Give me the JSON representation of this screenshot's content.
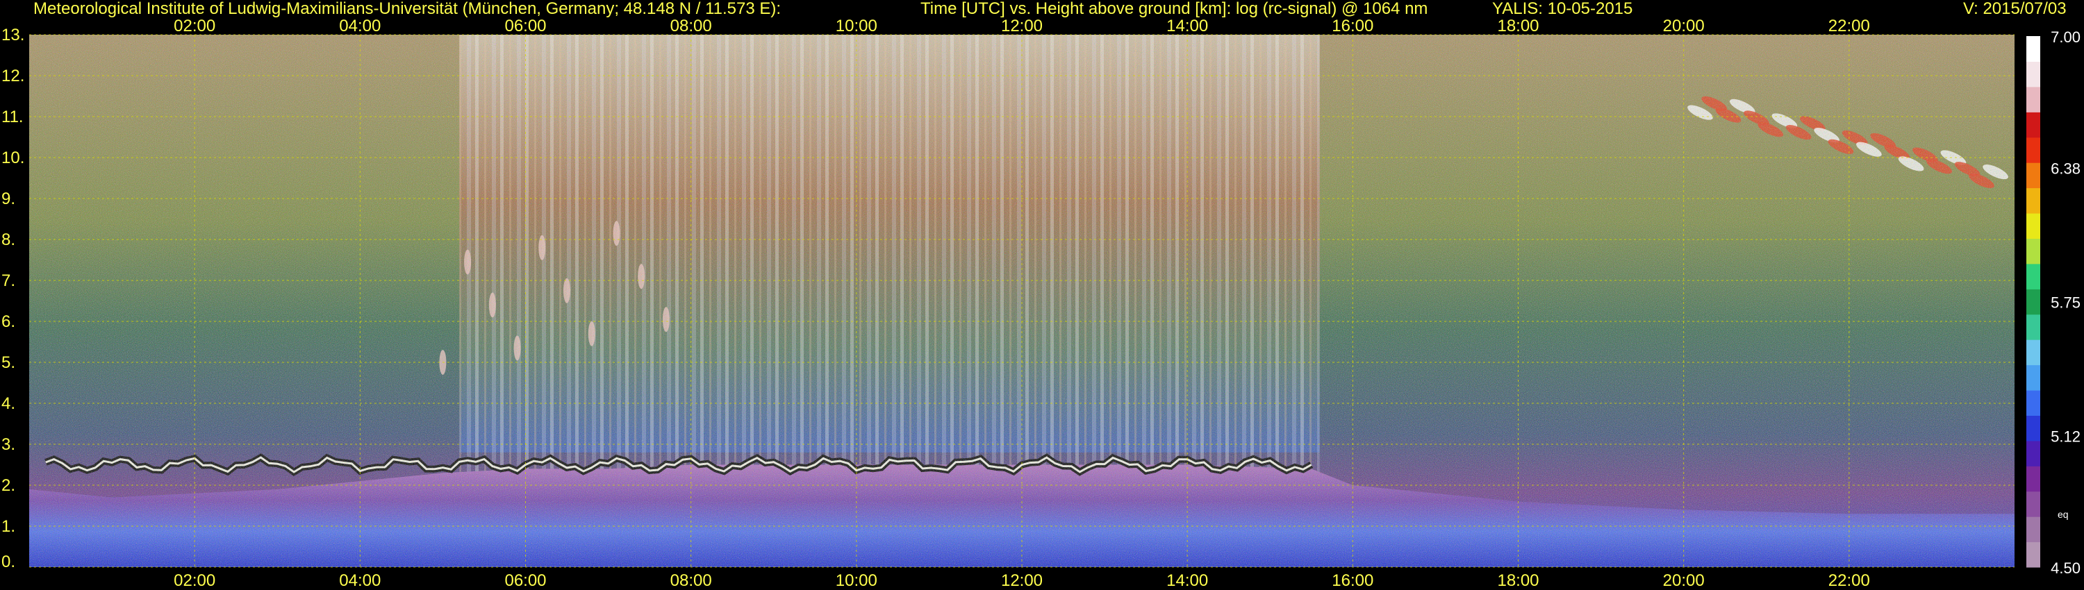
{
  "header": {
    "institute": "Meteorological Institute of Ludwig-Maximilians-Universität (München, Germany; 48.148 N / 11.573 E):",
    "description": "Time [UTC] vs. Height above ground [km]: log (rc-signal) @ 1064 nm",
    "instrument": "YALIS: 10-05-2015",
    "version": "V: 2015/07/03"
  },
  "colors": {
    "header_text": "#ffff4d",
    "tick_text": "#ffff4d",
    "grid": "#d8d800",
    "colorbar_labels": "#ffffff",
    "background": "#000000",
    "colormap": [
      "#b496b4",
      "#a078a8",
      "#8c4fa0",
      "#7a2a9a",
      "#4d1fb4",
      "#2a3ad8",
      "#3a6cf0",
      "#4aa0f0",
      "#6fc6ee",
      "#38c896",
      "#1ea050",
      "#2fd07a",
      "#b0e040",
      "#e8e818",
      "#f0b410",
      "#f07a10",
      "#e83010",
      "#d01818",
      "#e8b8c0",
      "#f4e4e8",
      "#ffffff"
    ]
  },
  "chart_data": {
    "type": "heatmap",
    "title": "Time [UTC] vs. Height above ground [km]: log (rc-signal) @ 1064 nm",
    "xlabel": "Time [UTC]",
    "ylabel": "Height above ground [km]",
    "xlim": [
      0,
      24
    ],
    "ylim": [
      0,
      13
    ],
    "x_ticks": [
      "02:00",
      "04:00",
      "06:00",
      "08:00",
      "10:00",
      "12:00",
      "14:00",
      "16:00",
      "18:00",
      "20:00",
      "22:00"
    ],
    "y_ticks": [
      "0.",
      "1.",
      "2.",
      "3.",
      "4.",
      "5.",
      "6.",
      "7.",
      "8.",
      "9.",
      "10.",
      "11.",
      "12.",
      "13."
    ],
    "grid": true,
    "colorbar": {
      "range": [
        4.5,
        7.0
      ],
      "labels": [
        "7.00",
        "6.38",
        "5.75",
        "5.12",
        "4.50"
      ],
      "extra_label": "eq"
    },
    "features": [
      {
        "name": "boundary layer top",
        "x_range": [
          0.2,
          15.5
        ],
        "height_km": 2.5
      },
      {
        "name": "cirrus",
        "x_range": [
          20.0,
          24.0
        ],
        "height_km_range": [
          9.0,
          11.5
        ]
      },
      {
        "name": "aerosol layer",
        "x_range": [
          5.0,
          8.0
        ],
        "height_km_range": [
          5.0,
          8.5
        ]
      }
    ]
  }
}
